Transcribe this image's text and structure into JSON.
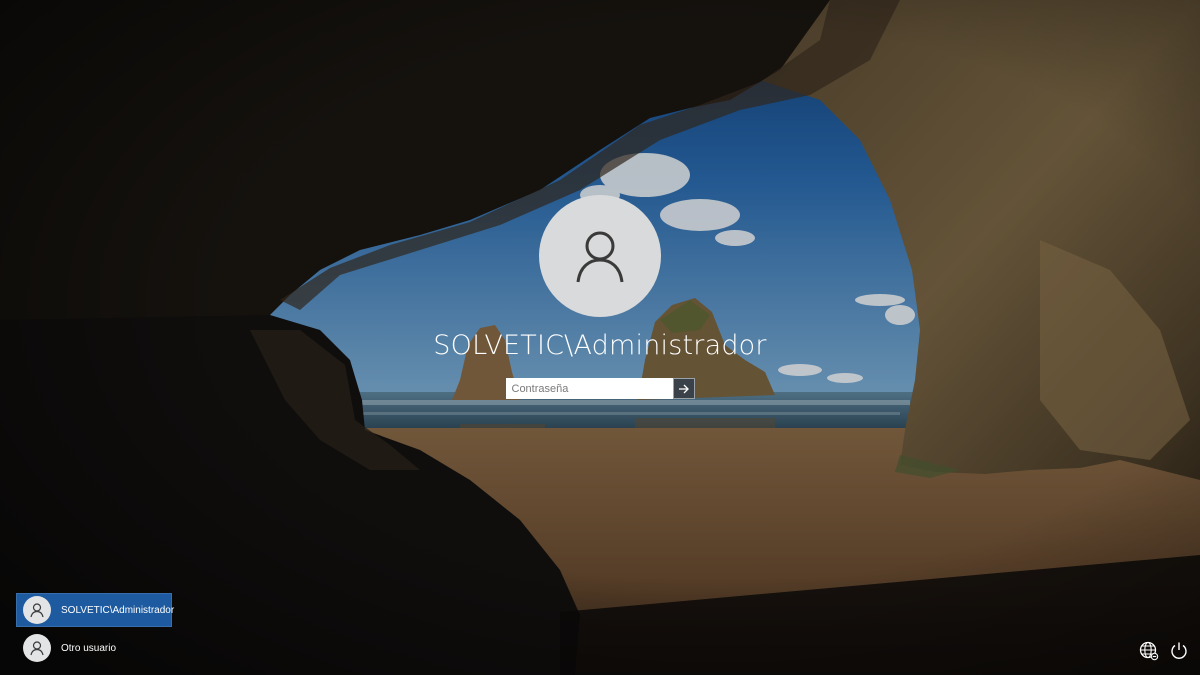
{
  "login": {
    "username": "SOLVETIC\\Administrador",
    "password_placeholder": "Contraseña",
    "submit_icon": "arrow-right-icon",
    "avatar_icon": "user-icon"
  },
  "users": [
    {
      "label": "SOLVETIC\\Administrador",
      "selected": true,
      "icon": "user-icon"
    },
    {
      "label": "Otro usuario",
      "selected": false,
      "icon": "user-icon"
    }
  ],
  "system_icons": {
    "network": "network-icon",
    "power": "power-icon"
  },
  "colors": {
    "selected_user_bg": "#1d5aa0",
    "avatar_bg": "#d9dadb",
    "text": "#ffffff"
  }
}
